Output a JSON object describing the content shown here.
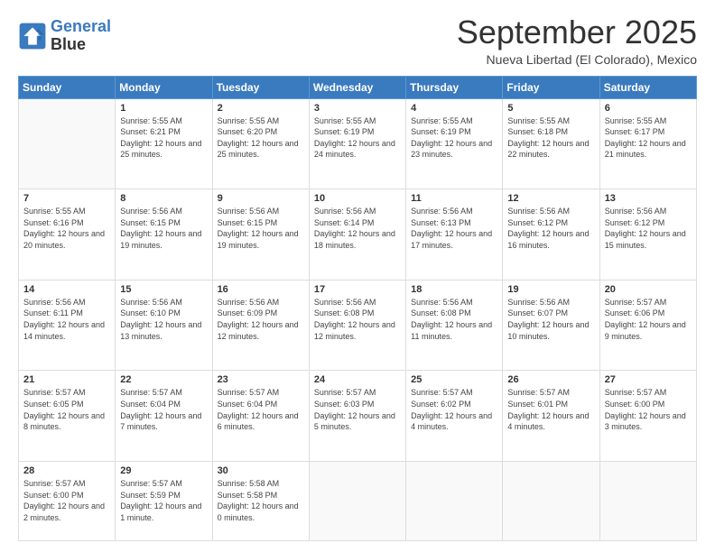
{
  "logo": {
    "line1": "General",
    "line2": "Blue"
  },
  "header": {
    "month": "September 2025",
    "location": "Nueva Libertad (El Colorado), Mexico"
  },
  "weekdays": [
    "Sunday",
    "Monday",
    "Tuesday",
    "Wednesday",
    "Thursday",
    "Friday",
    "Saturday"
  ],
  "weeks": [
    [
      {
        "day": "",
        "sunrise": "",
        "sunset": "",
        "daylight": ""
      },
      {
        "day": "1",
        "sunrise": "Sunrise: 5:55 AM",
        "sunset": "Sunset: 6:21 PM",
        "daylight": "Daylight: 12 hours and 25 minutes."
      },
      {
        "day": "2",
        "sunrise": "Sunrise: 5:55 AM",
        "sunset": "Sunset: 6:20 PM",
        "daylight": "Daylight: 12 hours and 25 minutes."
      },
      {
        "day": "3",
        "sunrise": "Sunrise: 5:55 AM",
        "sunset": "Sunset: 6:19 PM",
        "daylight": "Daylight: 12 hours and 24 minutes."
      },
      {
        "day": "4",
        "sunrise": "Sunrise: 5:55 AM",
        "sunset": "Sunset: 6:19 PM",
        "daylight": "Daylight: 12 hours and 23 minutes."
      },
      {
        "day": "5",
        "sunrise": "Sunrise: 5:55 AM",
        "sunset": "Sunset: 6:18 PM",
        "daylight": "Daylight: 12 hours and 22 minutes."
      },
      {
        "day": "6",
        "sunrise": "Sunrise: 5:55 AM",
        "sunset": "Sunset: 6:17 PM",
        "daylight": "Daylight: 12 hours and 21 minutes."
      }
    ],
    [
      {
        "day": "7",
        "sunrise": "Sunrise: 5:55 AM",
        "sunset": "Sunset: 6:16 PM",
        "daylight": "Daylight: 12 hours and 20 minutes."
      },
      {
        "day": "8",
        "sunrise": "Sunrise: 5:56 AM",
        "sunset": "Sunset: 6:15 PM",
        "daylight": "Daylight: 12 hours and 19 minutes."
      },
      {
        "day": "9",
        "sunrise": "Sunrise: 5:56 AM",
        "sunset": "Sunset: 6:15 PM",
        "daylight": "Daylight: 12 hours and 19 minutes."
      },
      {
        "day": "10",
        "sunrise": "Sunrise: 5:56 AM",
        "sunset": "Sunset: 6:14 PM",
        "daylight": "Daylight: 12 hours and 18 minutes."
      },
      {
        "day": "11",
        "sunrise": "Sunrise: 5:56 AM",
        "sunset": "Sunset: 6:13 PM",
        "daylight": "Daylight: 12 hours and 17 minutes."
      },
      {
        "day": "12",
        "sunrise": "Sunrise: 5:56 AM",
        "sunset": "Sunset: 6:12 PM",
        "daylight": "Daylight: 12 hours and 16 minutes."
      },
      {
        "day": "13",
        "sunrise": "Sunrise: 5:56 AM",
        "sunset": "Sunset: 6:12 PM",
        "daylight": "Daylight: 12 hours and 15 minutes."
      }
    ],
    [
      {
        "day": "14",
        "sunrise": "Sunrise: 5:56 AM",
        "sunset": "Sunset: 6:11 PM",
        "daylight": "Daylight: 12 hours and 14 minutes."
      },
      {
        "day": "15",
        "sunrise": "Sunrise: 5:56 AM",
        "sunset": "Sunset: 6:10 PM",
        "daylight": "Daylight: 12 hours and 13 minutes."
      },
      {
        "day": "16",
        "sunrise": "Sunrise: 5:56 AM",
        "sunset": "Sunset: 6:09 PM",
        "daylight": "Daylight: 12 hours and 12 minutes."
      },
      {
        "day": "17",
        "sunrise": "Sunrise: 5:56 AM",
        "sunset": "Sunset: 6:08 PM",
        "daylight": "Daylight: 12 hours and 12 minutes."
      },
      {
        "day": "18",
        "sunrise": "Sunrise: 5:56 AM",
        "sunset": "Sunset: 6:08 PM",
        "daylight": "Daylight: 12 hours and 11 minutes."
      },
      {
        "day": "19",
        "sunrise": "Sunrise: 5:56 AM",
        "sunset": "Sunset: 6:07 PM",
        "daylight": "Daylight: 12 hours and 10 minutes."
      },
      {
        "day": "20",
        "sunrise": "Sunrise: 5:57 AM",
        "sunset": "Sunset: 6:06 PM",
        "daylight": "Daylight: 12 hours and 9 minutes."
      }
    ],
    [
      {
        "day": "21",
        "sunrise": "Sunrise: 5:57 AM",
        "sunset": "Sunset: 6:05 PM",
        "daylight": "Daylight: 12 hours and 8 minutes."
      },
      {
        "day": "22",
        "sunrise": "Sunrise: 5:57 AM",
        "sunset": "Sunset: 6:04 PM",
        "daylight": "Daylight: 12 hours and 7 minutes."
      },
      {
        "day": "23",
        "sunrise": "Sunrise: 5:57 AM",
        "sunset": "Sunset: 6:04 PM",
        "daylight": "Daylight: 12 hours and 6 minutes."
      },
      {
        "day": "24",
        "sunrise": "Sunrise: 5:57 AM",
        "sunset": "Sunset: 6:03 PM",
        "daylight": "Daylight: 12 hours and 5 minutes."
      },
      {
        "day": "25",
        "sunrise": "Sunrise: 5:57 AM",
        "sunset": "Sunset: 6:02 PM",
        "daylight": "Daylight: 12 hours and 4 minutes."
      },
      {
        "day": "26",
        "sunrise": "Sunrise: 5:57 AM",
        "sunset": "Sunset: 6:01 PM",
        "daylight": "Daylight: 12 hours and 4 minutes."
      },
      {
        "day": "27",
        "sunrise": "Sunrise: 5:57 AM",
        "sunset": "Sunset: 6:00 PM",
        "daylight": "Daylight: 12 hours and 3 minutes."
      }
    ],
    [
      {
        "day": "28",
        "sunrise": "Sunrise: 5:57 AM",
        "sunset": "Sunset: 6:00 PM",
        "daylight": "Daylight: 12 hours and 2 minutes."
      },
      {
        "day": "29",
        "sunrise": "Sunrise: 5:57 AM",
        "sunset": "Sunset: 5:59 PM",
        "daylight": "Daylight: 12 hours and 1 minute."
      },
      {
        "day": "30",
        "sunrise": "Sunrise: 5:58 AM",
        "sunset": "Sunset: 5:58 PM",
        "daylight": "Daylight: 12 hours and 0 minutes."
      },
      {
        "day": "",
        "sunrise": "",
        "sunset": "",
        "daylight": ""
      },
      {
        "day": "",
        "sunrise": "",
        "sunset": "",
        "daylight": ""
      },
      {
        "day": "",
        "sunrise": "",
        "sunset": "",
        "daylight": ""
      },
      {
        "day": "",
        "sunrise": "",
        "sunset": "",
        "daylight": ""
      }
    ]
  ]
}
